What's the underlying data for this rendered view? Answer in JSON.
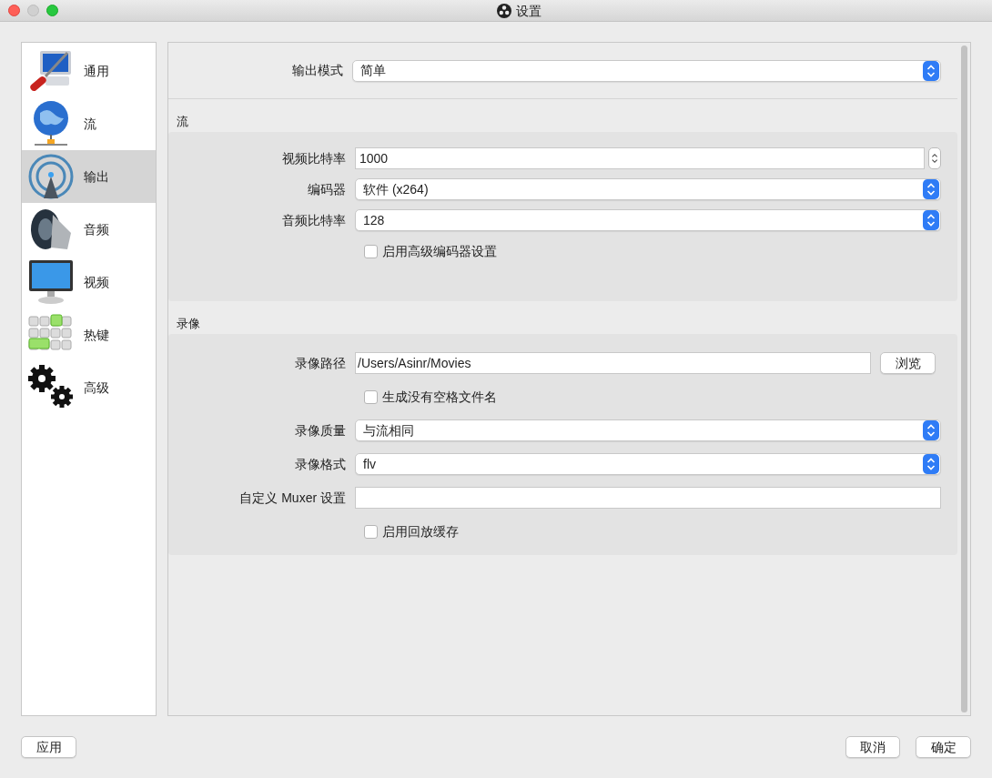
{
  "window": {
    "title": "设置"
  },
  "sidebar": {
    "items": [
      {
        "label": "通用",
        "kind": "general",
        "selected": false
      },
      {
        "label": "流",
        "kind": "stream",
        "selected": false
      },
      {
        "label": "输出",
        "kind": "output",
        "selected": true
      },
      {
        "label": "音频",
        "kind": "audio",
        "selected": false
      },
      {
        "label": "视频",
        "kind": "video",
        "selected": false
      },
      {
        "label": "热键",
        "kind": "hotkeys",
        "selected": false
      },
      {
        "label": "高级",
        "kind": "advanced",
        "selected": false
      }
    ]
  },
  "output_mode": {
    "label": "输出模式",
    "value": "简单"
  },
  "sections": [
    {
      "title": "流",
      "rows": [
        {
          "kind": "spinbox",
          "label": "视频比特率",
          "value": "1000"
        },
        {
          "kind": "select",
          "label": "编码器",
          "value": "软件 (x264)"
        },
        {
          "kind": "select",
          "label": "音频比特率",
          "value": "128"
        },
        {
          "kind": "checkbox",
          "label": "启用高级编码器设置",
          "checked": false
        }
      ]
    },
    {
      "title": "录像",
      "rows": [
        {
          "kind": "path",
          "label": "录像路径",
          "value": "/Users/Asinr/Movies",
          "button": "浏览"
        },
        {
          "kind": "checkbox",
          "label": "生成没有空格文件名",
          "checked": false
        },
        {
          "kind": "select",
          "label": "录像质量",
          "value": "与流相同"
        },
        {
          "kind": "select",
          "label": "录像格式",
          "value": "flv"
        },
        {
          "kind": "text",
          "label": "自定义 Muxer 设置"
        },
        {
          "kind": "checkbox",
          "label": "启用回放缓存",
          "checked": false
        }
      ]
    }
  ],
  "buttons": {
    "apply": "应用",
    "cancel": "取消",
    "ok": "确定"
  }
}
